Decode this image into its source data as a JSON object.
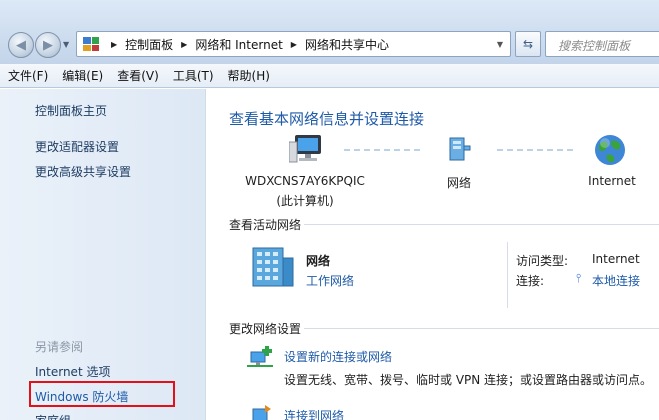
{
  "address": {
    "breadcrumbs": [
      "控制面板",
      "网络和 Internet",
      "网络和共享中心"
    ],
    "search_placeholder": "搜索控制面板"
  },
  "menu": [
    "文件(F)",
    "编辑(E)",
    "查看(V)",
    "工具(T)",
    "帮助(H)"
  ],
  "sidebar": {
    "links": [
      "控制面板主页",
      "更改适配器设置",
      "更改高级共享设置"
    ],
    "see_also_title": "另请参阅",
    "see_also": [
      "Internet 选项",
      "Windows 防火墙",
      "家庭组"
    ]
  },
  "main": {
    "title": "查看基本网络信息并设置连接",
    "map": {
      "computer_name": "WDXCNS7AY6KPQIC",
      "computer_note": "(此计算机)",
      "network": "网络",
      "internet": "Internet"
    },
    "active_header": "查看活动网络",
    "active": {
      "name": "网络",
      "type": "工作网络",
      "access_label": "访问类型:",
      "access_value": "Internet",
      "conn_label": "连接:",
      "conn_value": "本地连接"
    },
    "change_header": "更改网络设置",
    "tasks": [
      {
        "link": "设置新的连接或网络",
        "desc": "设置无线、宽带、拨号、临时或 VPN 连接；或设置路由器或访问点。"
      },
      {
        "link": "连接到网络",
        "desc": ""
      }
    ]
  },
  "colors": {
    "accent": "#1e5aa8",
    "highlight": "#e3101a"
  }
}
